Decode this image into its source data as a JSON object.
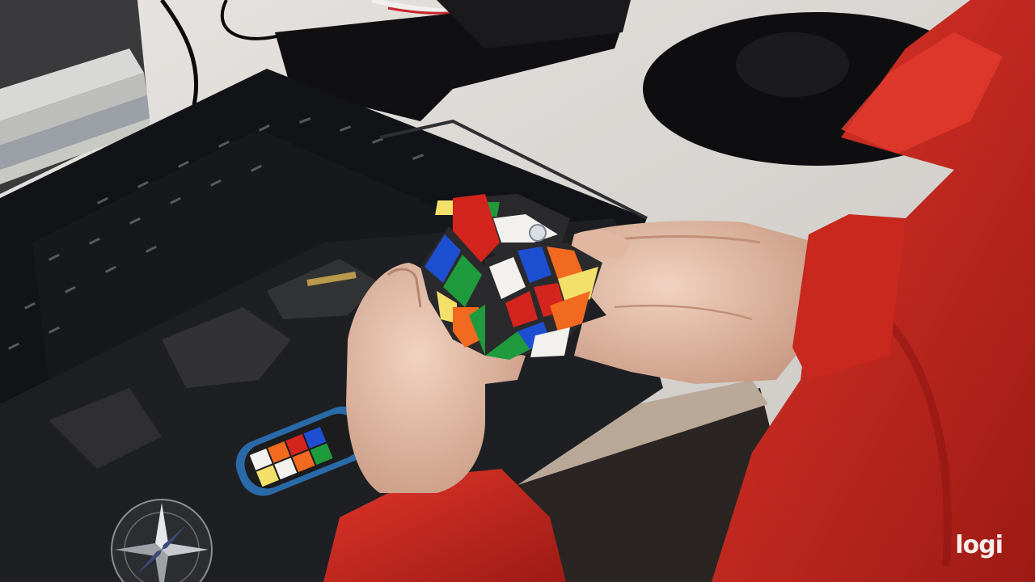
{
  "watermark": {
    "text": "logi",
    "icon": "logitech-logo-mark"
  },
  "colors": {
    "desk": "#dedbd8",
    "keyboard": "#121316",
    "mousepad": "#1e1f22",
    "sleeve": "#c4241c",
    "skin": "#e9c2ad",
    "cube_white": "#f2f1ee",
    "cube_red": "#d3241e",
    "cube_green": "#1f9a3c",
    "cube_blue": "#1f4fd1",
    "cube_orange": "#f26a1f",
    "cube_yellow": "#f3e06a"
  }
}
